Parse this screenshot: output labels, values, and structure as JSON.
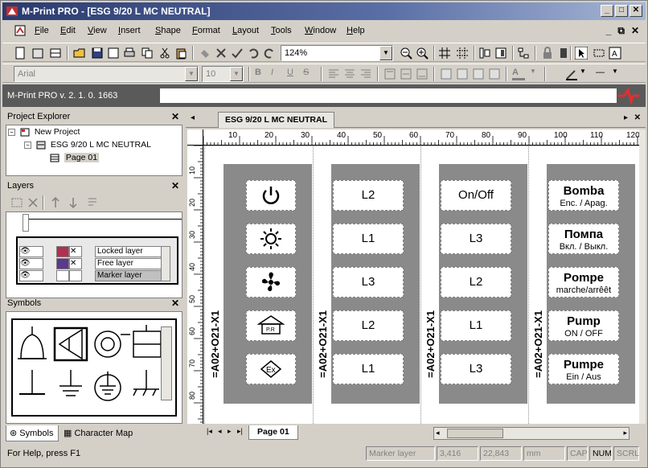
{
  "titlebar": {
    "title": "M-Print PRO - [ESG 9/20 L MC NEUTRAL]",
    "buttons": [
      "_",
      "□",
      "✕"
    ]
  },
  "menubar": {
    "items": [
      "File",
      "Edit",
      "View",
      "Insert",
      "Shape",
      "Format",
      "Layout",
      "Tools",
      "Window",
      "Help"
    ],
    "mdi_buttons": [
      "_",
      "⧉",
      "✕"
    ]
  },
  "toolbar1": {
    "zoom": "124%"
  },
  "toolbar2": {
    "font": "Arial",
    "size": "10"
  },
  "versionbar": {
    "version": "M-Print PRO v. 2. 1. 0. 1663"
  },
  "project_explorer": {
    "title": "Project Explorer",
    "items": [
      "New Project",
      "ESG 9/20 L MC NEUTRAL",
      "Page 01"
    ]
  },
  "layers": {
    "title": "Layers",
    "rows": [
      {
        "name": "Locked layer",
        "color": "#b03050"
      },
      {
        "name": "Free layer",
        "color": "#5a3a8a"
      },
      {
        "name": "Marker layer",
        "color": "#ffffff"
      }
    ]
  },
  "symbols": {
    "title": "Symbols",
    "tabs": [
      "Symbols",
      "Character Map"
    ]
  },
  "document": {
    "tab": "ESG 9/20 L MC NEUTRAL",
    "page_tab": "Page 01",
    "ruler_h": [
      "10",
      "20",
      "30",
      "40",
      "50",
      "60",
      "70",
      "80",
      "90",
      "100",
      "110",
      "120"
    ],
    "ruler_v": [
      "10",
      "20",
      "30",
      "40",
      "50",
      "60",
      "70",
      "80"
    ],
    "marker_text": "=A02+O21-X1",
    "col2": [
      "L2",
      "L1",
      "L3",
      "L2",
      "L1"
    ],
    "col3": [
      "On/Off",
      "L3",
      "L2",
      "L1",
      "L3"
    ],
    "col4": [
      {
        "big": "Bomba",
        "small": "Enc. / Apag."
      },
      {
        "big": "Помпа",
        "small": "Вкл. / Выкл."
      },
      {
        "big": "Pompe",
        "small": "marche/arrêêt"
      },
      {
        "big": "Pump",
        "small": "ON / OFF"
      },
      {
        "big": "Pumpe",
        "small": "Ein / Aus"
      }
    ],
    "col1_icons": [
      "power-icon",
      "sun-icon",
      "fan-icon",
      "pump-warning-icon",
      "ex-icon"
    ]
  },
  "statusbar": {
    "help": "For Help, press F1",
    "layer": "Marker layer",
    "x": "3,416",
    "y": "22,843",
    "unit": "mm",
    "cap": "CAP",
    "num": "NUM",
    "scrl": "SCRL"
  }
}
